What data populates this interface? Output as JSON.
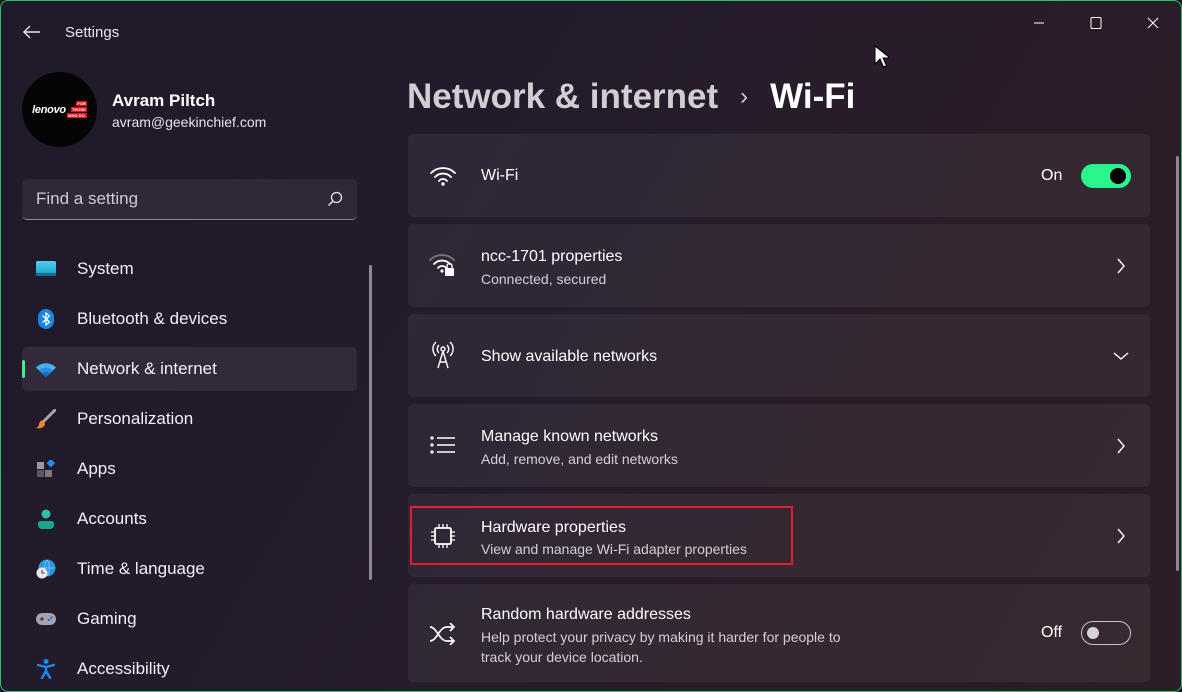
{
  "window": {
    "app_title": "Settings",
    "accent_color": "#1fc66b",
    "controls": {
      "minimize": "minimize-icon",
      "maximize": "maximize-icon",
      "close": "close-icon"
    }
  },
  "profile": {
    "name": "Avram Piltch",
    "email": "avram@geekinchief.com",
    "avatar_logo": "lenovo",
    "avatar_tagline": [
      "FOR",
      "THOSE",
      "WHO DO."
    ]
  },
  "search": {
    "placeholder": "Find a setting",
    "value": ""
  },
  "sidebar": {
    "items": [
      {
        "label": "System",
        "icon": "monitor-icon",
        "active": false
      },
      {
        "label": "Bluetooth & devices",
        "icon": "bluetooth-icon",
        "active": false
      },
      {
        "label": "Network & internet",
        "icon": "wifi-icon",
        "active": true
      },
      {
        "label": "Personalization",
        "icon": "paintbrush-icon",
        "active": false
      },
      {
        "label": "Apps",
        "icon": "apps-icon",
        "active": false
      },
      {
        "label": "Accounts",
        "icon": "person-icon",
        "active": false
      },
      {
        "label": "Time & language",
        "icon": "globe-clock-icon",
        "active": false
      },
      {
        "label": "Gaming",
        "icon": "gamepad-icon",
        "active": false
      },
      {
        "label": "Accessibility",
        "icon": "accessibility-icon",
        "active": false
      }
    ]
  },
  "header": {
    "breadcrumb_parent": "Network & internet",
    "separator": "›",
    "breadcrumb_current": "Wi-Fi"
  },
  "cards": [
    {
      "title": "Wi-Fi",
      "icon": "wifi-icon",
      "toggle_label": "On",
      "toggle_state": true
    },
    {
      "title": "ncc-1701 properties",
      "subtitle": "Connected, secured",
      "icon": "wifi-lock-icon",
      "action": "chevron-right"
    },
    {
      "title": "Show available networks",
      "icon": "antenna-icon",
      "action": "chevron-down"
    },
    {
      "title": "Manage known networks",
      "subtitle": "Add, remove, and edit networks",
      "icon": "list-icon",
      "action": "chevron-right"
    },
    {
      "title": "Hardware properties",
      "subtitle": "View and manage Wi-Fi adapter properties",
      "icon": "chip-icon",
      "action": "chevron-right",
      "highlighted": true
    },
    {
      "title": "Random hardware addresses",
      "subtitle_line1": "Help protect your privacy by making it harder for people to",
      "subtitle_line2": "track your device location.",
      "icon": "shuffle-icon",
      "toggle_label": "Off",
      "toggle_state": false
    }
  ]
}
